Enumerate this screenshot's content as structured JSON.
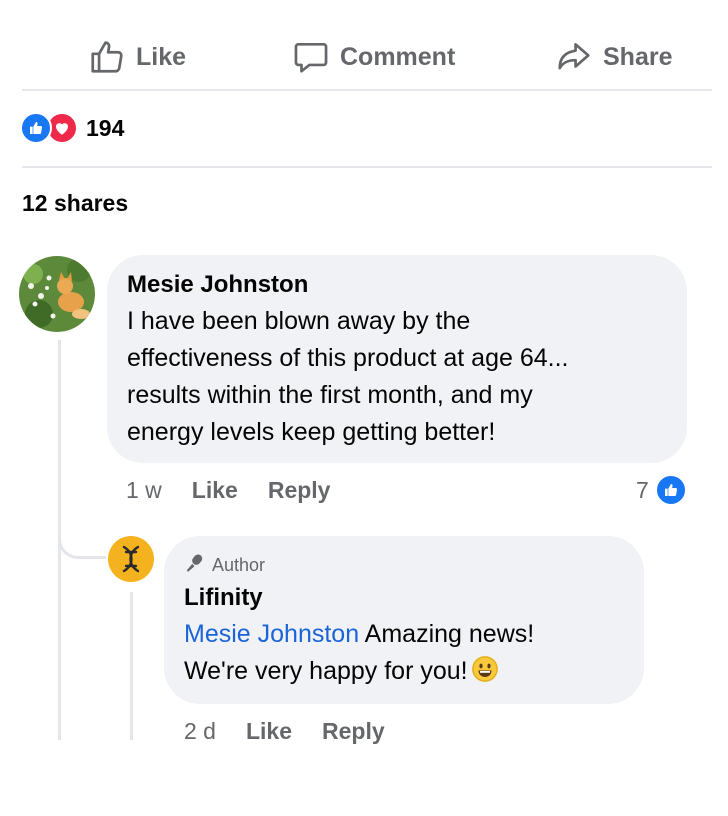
{
  "actions": {
    "like_label": "Like",
    "comment_label": "Comment",
    "share_label": "Share"
  },
  "reactions": {
    "count": "194",
    "icons": [
      "like-icon",
      "love-icon"
    ],
    "like_color": "#1877f2",
    "love_color": "#f0284a"
  },
  "shares_text": "12 shares",
  "comment": {
    "author": "Mesie Johnston",
    "text_lines": [
      "I have been blown away by the",
      "effectiveness of this product at age 64...",
      "results within the first month, and my",
      "energy levels keep getting better!"
    ],
    "time": "1 w",
    "like_label": "Like",
    "reply_label": "Reply",
    "like_count": "7"
  },
  "reply": {
    "badge": "Author",
    "author": "Lifinity",
    "mention": "Mesie Johnston",
    "text_line1": " Amazing news!",
    "text_line2": "We're very happy for you!",
    "time": "2 d",
    "like_label": "Like",
    "reply_label": "Reply",
    "avatar_color": "#f4b21e",
    "mention_color": "#1b64d8"
  }
}
